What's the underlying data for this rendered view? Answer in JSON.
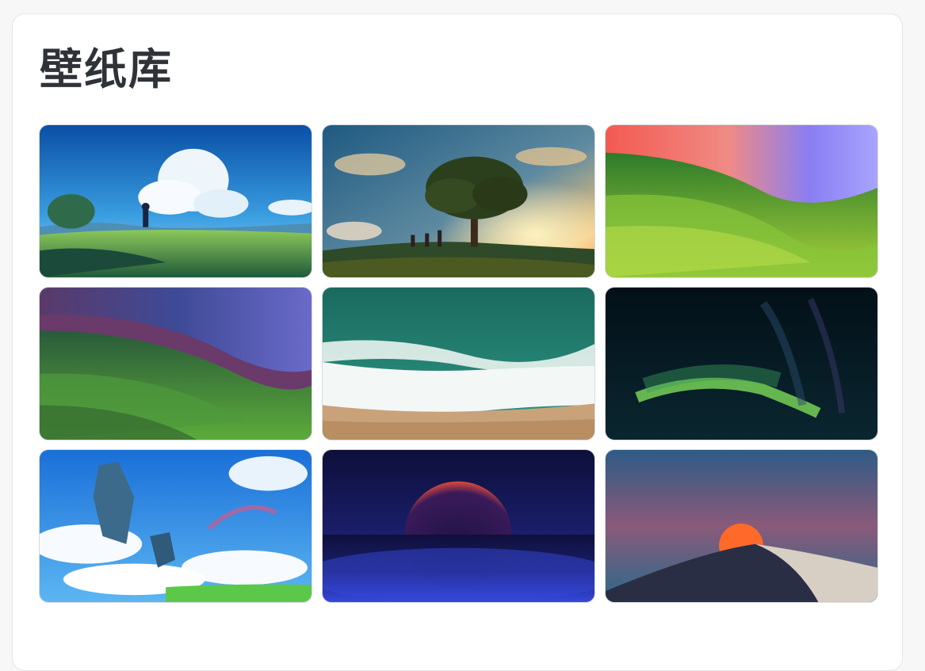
{
  "page": {
    "title": "壁纸库"
  },
  "wallpapers": [
    {
      "scene": "anime-meadow-clouds-girl",
      "colors": [
        "#0c5fb4",
        "#3a9ee0",
        "#5aa846"
      ]
    },
    {
      "scene": "anime-tree-sunset-children",
      "colors": [
        "#1d4f73",
        "#f2b765",
        "#3c5a2a"
      ]
    },
    {
      "scene": "sonoma-wave-sunset",
      "colors": [
        "#f27060",
        "#8a7cf0",
        "#6fa83a"
      ]
    },
    {
      "scene": "sonoma-wave-night",
      "colors": [
        "#4a3a8c",
        "#6b4a8f",
        "#4e9a3c"
      ]
    },
    {
      "scene": "ocean-waves-beach",
      "colors": [
        "#1f7a6a",
        "#e8eeee",
        "#c9a37a"
      ]
    },
    {
      "scene": "aurora-night",
      "colors": [
        "#051522",
        "#7edc5a",
        "#0a2a30"
      ]
    },
    {
      "scene": "fantasy-floating-islands-dragon",
      "colors": [
        "#1a7de0",
        "#ffffff",
        "#5cc84a"
      ]
    },
    {
      "scene": "red-planet-eclipse",
      "colors": [
        "#0d0f3a",
        "#e04a3a",
        "#2a38d8"
      ]
    },
    {
      "scene": "desert-dune-sunset",
      "colors": [
        "#2e5b85",
        "#ff6a2a",
        "#d8cfc4"
      ]
    }
  ]
}
